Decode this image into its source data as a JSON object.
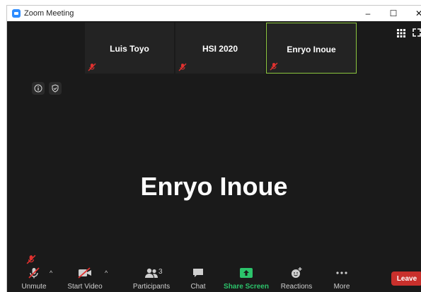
{
  "window": {
    "title": "Zoom Meeting"
  },
  "thumbnails": [
    {
      "name": "Luis Toyo",
      "active": false
    },
    {
      "name": "HSI 2020",
      "active": false
    },
    {
      "name": "Enryo Inoue",
      "active": true
    }
  ],
  "speaker": {
    "name": "Enryo Inoue"
  },
  "toolbar": {
    "unmute": "Unmute",
    "start_video": "Start Video",
    "participants": "Participants",
    "participants_count": "3",
    "chat": "Chat",
    "share_screen": "Share Screen",
    "reactions": "Reactions",
    "more": "More",
    "leave": "Leave"
  },
  "colors": {
    "accent_green": "#2cc36b",
    "active_border": "#8cc63f",
    "leave_red": "#c9302c",
    "muted_red": "#e0312f"
  }
}
